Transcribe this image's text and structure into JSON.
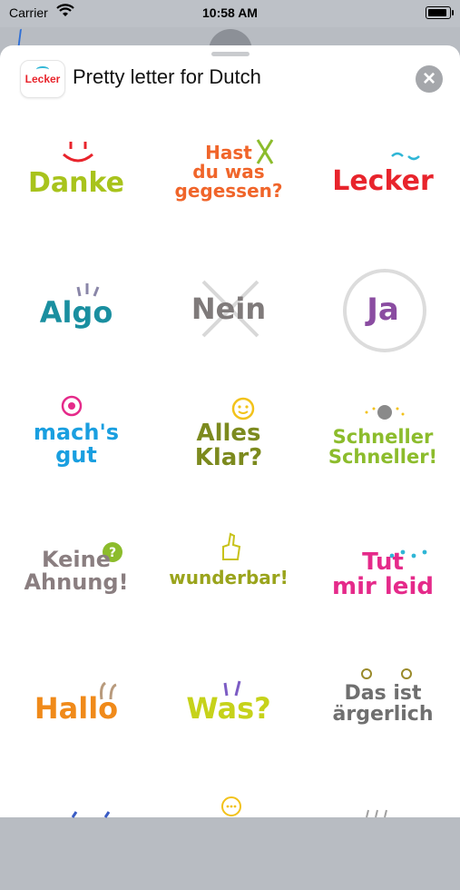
{
  "status_bar": {
    "carrier": "Carrier",
    "time": "10:58 AM"
  },
  "header": {
    "app_icon_label": "Lecker",
    "title": "Pretty letter for Dutch"
  },
  "stickers": [
    {
      "text": "Danke",
      "color": "#a8c31c"
    },
    {
      "text": "Hast\ndu was\ngegessen?",
      "color": "#f0652a"
    },
    {
      "text": "Lecker",
      "color": "#e8242c"
    },
    {
      "text": "Algo",
      "color": "#1a8fa0"
    },
    {
      "text": "Nein",
      "color": "#7f7a7a"
    },
    {
      "text": "Ja",
      "color": "#8a4ca1"
    },
    {
      "text": "mach's\ngut",
      "color": "#1a9fe0"
    },
    {
      "text": "Alles\nKlar?",
      "color": "#7c8a1e"
    },
    {
      "text": "Schneller\nSchneller!",
      "color": "#8cbc2c"
    },
    {
      "text": "Keine\nAhnung!",
      "color": "#8a7e80"
    },
    {
      "text": "wunderbar!",
      "color": "#9aa41c"
    },
    {
      "text": "Tut\nmir leid",
      "color": "#e52a8a"
    },
    {
      "text": "Hallo",
      "color": "#f08a1a"
    },
    {
      "text": "Was?",
      "color": "#c6d21a"
    },
    {
      "text": "Das ist\närgerlich",
      "color": "#6f6f6f"
    }
  ]
}
